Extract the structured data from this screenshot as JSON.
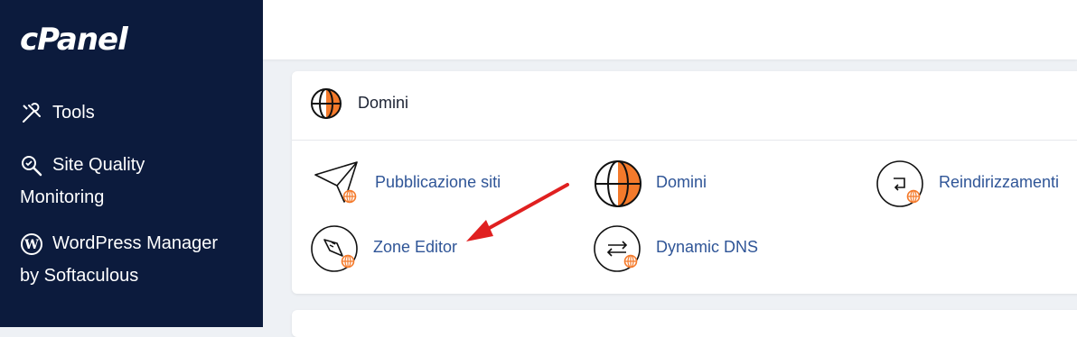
{
  "sidebar": {
    "logo": "cPanel",
    "items": [
      {
        "icon": "tools-icon",
        "label": "Tools"
      },
      {
        "icon": "site-quality-icon",
        "label_line1": "Site Quality",
        "label_line2": "Monitoring"
      },
      {
        "icon": "wordpress-icon",
        "label_line1": "WordPress Manager",
        "label_line2": "by Softaculous"
      }
    ]
  },
  "section": {
    "icon": "globe-icon",
    "title": "Domini",
    "tiles": [
      {
        "icon": "paper-plane-icon",
        "label": "Pubblicazione siti"
      },
      {
        "icon": "globe-icon",
        "label": "Domini"
      },
      {
        "icon": "redirect-icon",
        "label": "Reindirizzamenti"
      },
      {
        "icon": "zone-editor-icon",
        "label": "Zone Editor"
      },
      {
        "icon": "dynamic-dns-icon",
        "label": "Dynamic DNS"
      }
    ]
  },
  "colors": {
    "sidebar_bg": "#0c1b3d",
    "accent": "#f47a2b",
    "link": "#2f5597",
    "annotation_arrow": "#e02020"
  }
}
